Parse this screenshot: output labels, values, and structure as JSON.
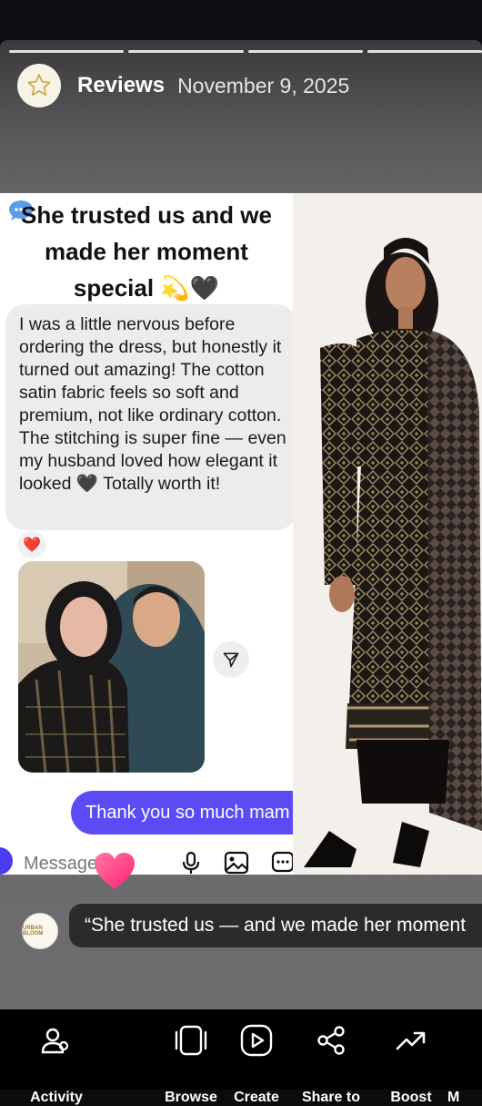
{
  "story": {
    "account_name": "Reviews",
    "date": "November 9, 2025",
    "segments": 4
  },
  "post": {
    "heading": "She trusted us  and we made her moment special",
    "heading_emoji": "💫🖤",
    "review_text": "I was a little nervous before ordering the dress, but honestly it turned out amazing! The cotton satin fabric feels so soft and premium, not like ordinary cotton. The stitching is super fine — even my husband loved how elegant it looked 🖤 Totally worth it!",
    "reaction": "❤️",
    "sent_message": "Thank you so much mam",
    "composer_placeholder": "Message..."
  },
  "caption": {
    "avatar_text": "URBAN BLOOM",
    "text": "“She trusted us — and we made her moment"
  },
  "bottom_bar": {
    "items": [
      {
        "label": "Activity",
        "icon": "activity-people-icon"
      },
      {
        "label": "Browse",
        "icon": "browse-cards-icon"
      },
      {
        "label": "Create",
        "icon": "create-play-icon"
      },
      {
        "label": "Share to",
        "icon": "share-nodes-icon"
      },
      {
        "label": "Boost",
        "icon": "boost-trend-icon"
      },
      {
        "label": "M",
        "icon": "more-icon"
      }
    ]
  },
  "colors": {
    "sent_bubble": "#5b4bf5",
    "received_bubble": "#ececec",
    "caption_bg": "#2b2b2d",
    "story_bg": "#6a6a6c"
  }
}
